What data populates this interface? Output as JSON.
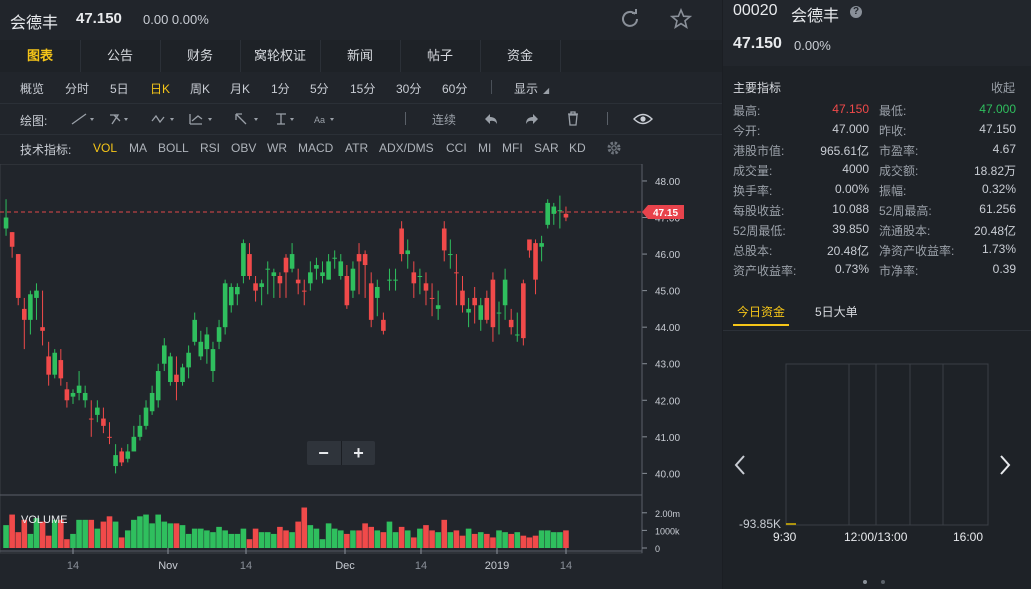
{
  "header": {
    "name": "会德丰",
    "price": "47.150",
    "change": "0.00 0.00%"
  },
  "tabs": [
    {
      "label": "图表",
      "active": true
    },
    {
      "label": "公告"
    },
    {
      "label": "财务"
    },
    {
      "label": "窝轮权证"
    },
    {
      "label": "新闻"
    },
    {
      "label": "帖子"
    },
    {
      "label": "资金"
    }
  ],
  "periods": [
    "概览",
    "分时",
    "5日",
    "日K",
    "周K",
    "月K",
    "1分",
    "5分",
    "15分",
    "30分",
    "60分"
  ],
  "active_period": "日K",
  "display_label": "显示",
  "draw_label": "绘图:",
  "draw_tools": [
    "line-tool-icon",
    "fork-tool-icon",
    "wave-tool-icon",
    "pattern-tool-icon",
    "arrow-tool-icon",
    "text-tool-icon",
    "font-tool-icon",
    "bars-tool-icon"
  ],
  "continuous_label": "连续",
  "indicator_label": "技术指标:",
  "indicators": [
    "VOL",
    "MA",
    "BOLL",
    "RSI",
    "OBV",
    "WR",
    "MACD",
    "ATR",
    "ADX/DMS",
    "CCI",
    "MI",
    "MFI",
    "SAR",
    "KD"
  ],
  "active_indicator": "VOL",
  "volume_label": "VOLUME",
  "price_tag": "47.15",
  "zoom": {
    "minus": "−",
    "plus": "+"
  },
  "chart_data": {
    "type": "candlestick",
    "y_ticks": [
      "48.00",
      "47.00",
      "46.00",
      "45.00",
      "44.00",
      "43.00",
      "42.00",
      "41.00",
      "40.00"
    ],
    "ylim": [
      39.6,
      48.3
    ],
    "last_price": 47.15,
    "vol_ticks": [
      "2.00m",
      "1000k",
      "0"
    ],
    "x_labels": [
      "14",
      "Nov",
      "14",
      "Dec",
      "14",
      "2019",
      "14"
    ],
    "candles": [
      [
        46.7,
        47.5,
        47.0,
        46.5,
        1
      ],
      [
        46.2,
        46.6,
        46.6,
        45.9,
        0
      ],
      [
        46.0,
        46.0,
        44.8,
        44.6,
        0
      ],
      [
        44.5,
        44.8,
        44.2,
        43.4,
        0
      ],
      [
        44.2,
        45.0,
        44.9,
        43.8,
        1
      ],
      [
        44.8,
        45.2,
        45.0,
        44.2,
        1
      ],
      [
        44.0,
        45.0,
        43.9,
        43.5,
        0
      ],
      [
        43.2,
        43.6,
        42.7,
        42.4,
        0
      ],
      [
        42.7,
        43.4,
        43.3,
        42.6,
        1
      ],
      [
        43.1,
        43.4,
        42.6,
        42.4,
        0
      ],
      [
        42.3,
        42.5,
        42.0,
        41.8,
        0
      ],
      [
        42.1,
        42.3,
        42.2,
        41.9,
        1
      ],
      [
        42.2,
        42.8,
        42.4,
        42.0,
        1
      ],
      [
        42.0,
        42.4,
        42.2,
        41.8,
        1
      ],
      [
        41.5,
        42.0,
        41.5,
        41.0,
        0
      ],
      [
        41.6,
        42.0,
        41.8,
        41.4,
        1
      ],
      [
        41.5,
        41.8,
        41.3,
        41.1,
        0
      ],
      [
        41.0,
        41.4,
        41.0,
        40.8,
        0
      ],
      [
        40.2,
        40.8,
        40.5,
        40.0,
        1
      ],
      [
        40.6,
        40.7,
        40.3,
        40.2,
        0
      ],
      [
        40.4,
        40.8,
        40.6,
        40.3,
        1
      ],
      [
        40.6,
        41.3,
        41.0,
        40.6,
        1
      ],
      [
        41.0,
        41.6,
        41.3,
        40.9,
        1
      ],
      [
        41.3,
        42.0,
        41.8,
        41.2,
        1
      ],
      [
        41.7,
        42.4,
        42.2,
        41.6,
        1
      ],
      [
        42.0,
        43.0,
        42.8,
        41.8,
        1
      ],
      [
        43.0,
        43.7,
        43.5,
        42.8,
        1
      ],
      [
        42.5,
        43.3,
        43.2,
        42.4,
        1
      ],
      [
        42.5,
        43.2,
        42.7,
        42.0,
        0
      ],
      [
        42.5,
        43.0,
        42.9,
        42.4,
        1
      ],
      [
        42.9,
        43.5,
        43.3,
        42.6,
        1
      ],
      [
        43.6,
        44.4,
        44.2,
        43.5,
        1
      ],
      [
        43.2,
        43.9,
        43.6,
        43.1,
        1
      ],
      [
        43.4,
        44.0,
        43.8,
        43.0,
        1
      ],
      [
        42.8,
        43.6,
        43.4,
        42.5,
        1
      ],
      [
        43.6,
        44.2,
        44.0,
        43.4,
        1
      ],
      [
        44.0,
        45.3,
        45.2,
        43.8,
        1
      ],
      [
        44.6,
        45.2,
        45.1,
        44.4,
        1
      ],
      [
        44.9,
        45.2,
        45.1,
        44.6,
        1
      ],
      [
        45.4,
        46.4,
        46.3,
        45.2,
        1
      ],
      [
        46.0,
        46.3,
        45.4,
        45.3,
        0
      ],
      [
        45.0,
        45.4,
        45.2,
        44.7,
        0
      ],
      [
        45.1,
        45.3,
        45.2,
        44.6,
        1
      ],
      [
        45.6,
        45.8,
        45.6,
        44.9,
        1
      ],
      [
        45.4,
        45.6,
        45.5,
        44.8,
        1
      ],
      [
        45.2,
        45.5,
        45.4,
        44.8,
        0
      ],
      [
        45.9,
        46.0,
        45.5,
        44.8,
        0
      ],
      [
        45.6,
        46.3,
        46.0,
        45.5,
        1
      ],
      [
        45.3,
        45.6,
        45.2,
        44.9,
        0
      ],
      [
        45.0,
        45.3,
        45.0,
        44.6,
        0
      ],
      [
        45.2,
        45.8,
        45.5,
        45.0,
        1
      ],
      [
        45.6,
        45.9,
        45.7,
        45.3,
        1
      ],
      [
        45.4,
        45.8,
        45.5,
        45.2,
        1
      ],
      [
        45.3,
        46.0,
        45.8,
        45.3,
        1
      ],
      [
        45.9,
        46.1,
        45.9,
        45.6,
        1
      ],
      [
        45.4,
        46.0,
        45.8,
        45.3,
        1
      ],
      [
        44.6,
        45.7,
        45.4,
        44.5,
        0
      ],
      [
        45.0,
        45.8,
        45.6,
        44.8,
        1
      ],
      [
        46.0,
        46.3,
        45.8,
        44.9,
        0
      ],
      [
        46.0,
        46.1,
        45.7,
        44.8,
        0
      ],
      [
        45.2,
        45.5,
        44.2,
        44.0,
        0
      ],
      [
        44.8,
        45.3,
        45.1,
        44.3,
        1
      ],
      [
        43.9,
        44.4,
        44.2,
        43.8,
        0
      ],
      [
        45.3,
        45.6,
        45.3,
        45.0,
        1
      ],
      [
        45.3,
        45.6,
        45.3,
        45.0,
        1
      ],
      [
        46.7,
        46.9,
        46.0,
        45.8,
        0
      ],
      [
        46.0,
        46.4,
        46.1,
        45.6,
        1
      ],
      [
        45.5,
        45.8,
        45.2,
        44.8,
        0
      ],
      [
        45.4,
        45.6,
        45.4,
        44.9,
        1
      ],
      [
        45.2,
        45.5,
        45.0,
        44.6,
        0
      ],
      [
        44.8,
        45.2,
        44.8,
        44.3,
        0
      ],
      [
        44.5,
        45.0,
        44.6,
        44.2,
        1
      ],
      [
        46.7,
        46.9,
        46.1,
        45.8,
        0
      ],
      [
        46.0,
        46.4,
        46.0,
        45.6,
        1
      ],
      [
        45.5,
        46.0,
        45.5,
        44.6,
        0
      ],
      [
        45.0,
        45.4,
        44.6,
        44.4,
        0
      ],
      [
        44.4,
        44.8,
        44.5,
        44.0,
        1
      ],
      [
        44.6,
        45.1,
        44.8,
        44.1,
        0
      ],
      [
        44.2,
        44.8,
        44.6,
        43.9,
        1
      ],
      [
        44.2,
        45.0,
        44.8,
        44.1,
        0
      ],
      [
        45.3,
        45.5,
        44.0,
        43.6,
        0
      ],
      [
        44.4,
        44.7,
        44.4,
        43.8,
        1
      ],
      [
        45.3,
        45.6,
        44.6,
        44.2,
        1
      ],
      [
        44.0,
        44.5,
        44.2,
        43.8,
        0
      ],
      [
        43.8,
        44.4,
        43.8,
        43.6,
        1
      ],
      [
        45.2,
        45.3,
        43.7,
        43.5,
        0
      ],
      [
        46.1,
        46.2,
        46.4,
        45.9,
        0
      ],
      [
        45.3,
        46.4,
        46.3,
        44.9,
        0
      ],
      [
        46.3,
        46.5,
        46.2,
        45.8,
        1
      ],
      [
        46.8,
        47.5,
        47.4,
        46.7,
        1
      ],
      [
        47.1,
        47.4,
        47.3,
        46.8,
        1
      ],
      [
        47.2,
        47.6,
        47.2,
        46.7,
        1
      ],
      [
        47.1,
        47.3,
        47.0,
        46.9,
        0
      ]
    ],
    "volumes": [
      1.3,
      1.9,
      0.9,
      1.6,
      0.8,
      1.7,
      1.5,
      0.7,
      1.6,
      1.6,
      0.5,
      0.8,
      1.6,
      1.6,
      1.6,
      1.1,
      1.5,
      1.8,
      1.5,
      0.6,
      1.0,
      1.6,
      1.8,
      1.9,
      1.4,
      1.9,
      1.5,
      1.4,
      1.4,
      1.3,
      0.8,
      1.1,
      1.1,
      1.0,
      0.9,
      1.2,
      1.0,
      0.8,
      0.8,
      1.1,
      0.5,
      1.1,
      0.9,
      0.9,
      0.8,
      1.2,
      1.0,
      0.9,
      1.5,
      2.3,
      1.3,
      1.1,
      0.5,
      1.4,
      1.1,
      1.0,
      0.8,
      1.0,
      1.0,
      1.4,
      1.2,
      1.0,
      0.9,
      1.5,
      0.9,
      1.2,
      1.0,
      0.6,
      1.1,
      1.3,
      1.0,
      0.9,
      1.6,
      0.9,
      1.0,
      0.7,
      1.1,
      0.8,
      0.9,
      0.8,
      0.6,
      1.0,
      0.9,
      0.8,
      0.9,
      0.7,
      0.6,
      0.7,
      1.0,
      1.0,
      0.9,
      0.9,
      1.0
    ]
  },
  "right": {
    "code": "00020",
    "name": "会德丰",
    "price": "47.150",
    "change": "0.00%",
    "section_title": "主要指标",
    "collapse": "收起",
    "stats": [
      [
        "最高:",
        "47.150",
        "最低:",
        "47.000"
      ],
      [
        "今开:",
        "47.000",
        "昨收:",
        "47.150"
      ],
      [
        "港股市值:",
        "965.61亿",
        "市盈率:",
        "4.67"
      ],
      [
        "成交量:",
        "4000",
        "成交额:",
        "18.82万"
      ],
      [
        "换手率:",
        "0.00%",
        "振幅:",
        "0.32%"
      ],
      [
        "每股收益:",
        "10.088",
        "52周最高:",
        "61.256"
      ],
      [
        "52周最低:",
        "39.850",
        "流通股本:",
        "20.48亿"
      ],
      [
        "总股本:",
        "20.48亿",
        "净资产收益率:",
        "1.73%"
      ],
      [
        "资产收益率:",
        "0.73%",
        "市净率:",
        "0.39"
      ]
    ],
    "fund_tabs": [
      {
        "label": "今日资金",
        "active": true
      },
      {
        "label": "5日大单"
      }
    ],
    "fund_value": "-93.85K",
    "fund_times": [
      "9:30",
      "12:00/13:00",
      "16:00"
    ]
  }
}
